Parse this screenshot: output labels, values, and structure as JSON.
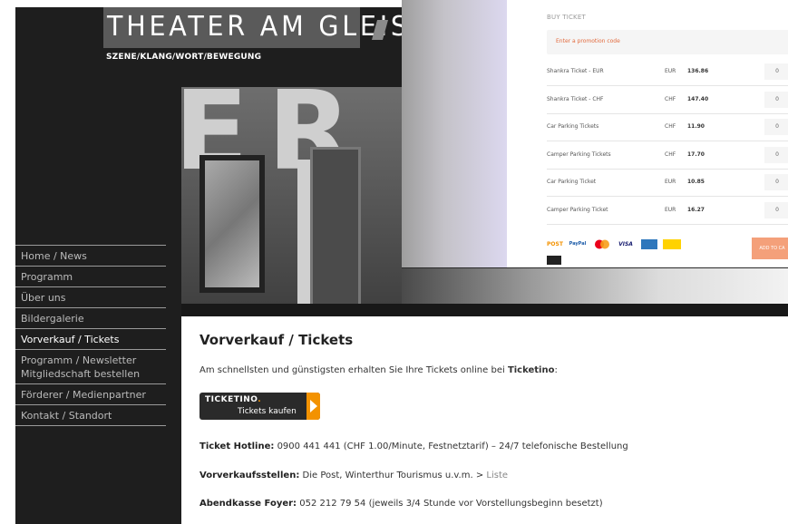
{
  "logo": {
    "text": "THEATER AM GLEIS",
    "tagline": "SZENE/KLANG/WORT/BEWEGUNG"
  },
  "popup": {
    "title": "BUY TICKET",
    "promo_placeholder": "Enter a promotion code",
    "rows": [
      {
        "name": "Shankra Ticket - EUR",
        "currency": "EUR",
        "price": "136.86",
        "qty": "0"
      },
      {
        "name": "Shankra Ticket - CHF",
        "currency": "CHF",
        "price": "147.40",
        "qty": "0"
      },
      {
        "name": "Car Parking Tickets",
        "currency": "CHF",
        "price": "11.90",
        "qty": "0"
      },
      {
        "name": "Camper Parking Tickets",
        "currency": "CHF",
        "price": "17.70",
        "qty": "0"
      },
      {
        "name": "Car Parking Ticket",
        "currency": "EUR",
        "price": "10.85",
        "qty": "0"
      },
      {
        "name": "Camper Parking Ticket",
        "currency": "EUR",
        "price": "16.27",
        "qty": "0"
      }
    ],
    "payment_methods": [
      "Post",
      "PayPal",
      "Mastercard",
      "VISA",
      "Amex",
      "PostFinance",
      "Twint"
    ],
    "add_to_cart": "ADD TO CA"
  },
  "nav": {
    "items": [
      "Home / News",
      "Programm",
      "Über uns",
      "Bildergalerie",
      "Vorverkauf / Tickets",
      "Programm / Newsletter\nMitgliedschaft bestellen",
      "Förderer / Medienpartner",
      "Kontakt / Standort"
    ],
    "active_index": 4
  },
  "content": {
    "title": "Vorverkauf / Tickets",
    "intro_prefix": "Am schnellsten und günstigsten erhalten Sie Ihre Tickets online bei ",
    "intro_bold": "Ticketino",
    "intro_suffix": ":",
    "ticketino_logo": "TICKETINO",
    "ticketino_button": "Tickets kaufen",
    "hotline_label": "Ticket Hotline:",
    "hotline_text": " 0900 441 441 (CHF 1.00/Minute, Festnetztarif) – 24/7 telefonische Bestellung",
    "vvk_label": "Vorverkaufsstellen:",
    "vvk_text": " Die Post, Winterthur Tourismus u.v.m. > ",
    "vvk_link": "Liste",
    "abend_label": "Abendkasse Foyer:",
    "abend_text": " 052 212 79 54 (jeweils 3/4 Stunde vor Vorstellungsbeginn besetzt)"
  },
  "colors": {
    "dark": "#1e1e1e",
    "accent": "#f39200",
    "promo_text": "#e26a3d"
  }
}
